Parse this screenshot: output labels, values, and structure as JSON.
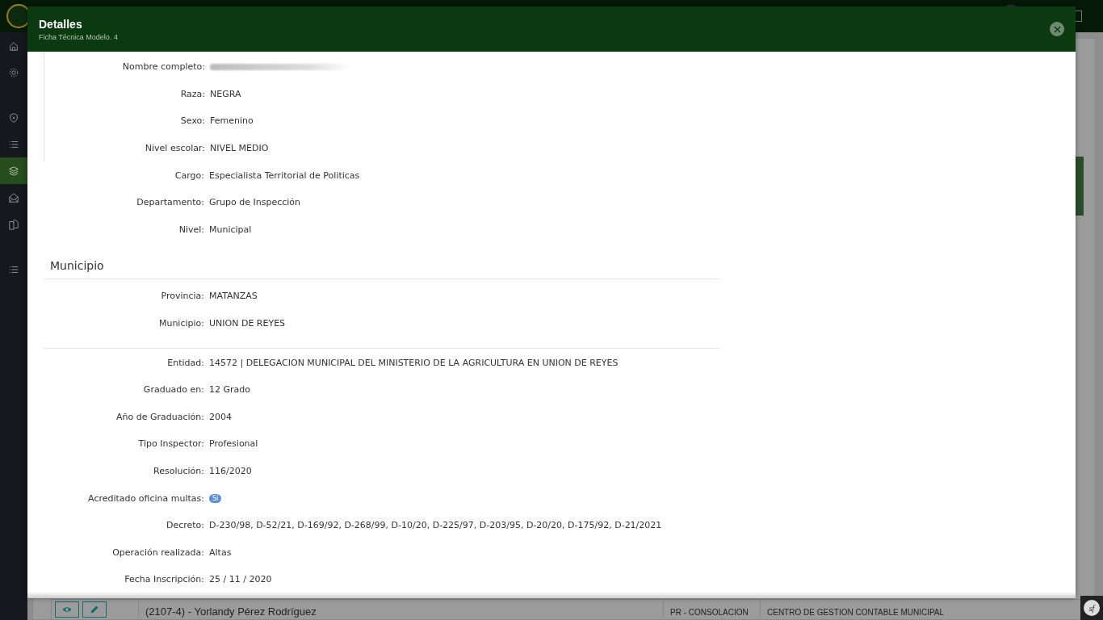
{
  "sidebar": {
    "items": [
      {
        "kind": "home",
        "selected": false
      },
      {
        "kind": "gear",
        "selected": false
      },
      {
        "kind": "shield",
        "selected": false
      },
      {
        "kind": "list",
        "selected": false
      },
      {
        "kind": "layers",
        "selected": true
      },
      {
        "kind": "envelope",
        "selected": false
      },
      {
        "kind": "copy",
        "selected": false
      },
      {
        "kind": "list",
        "selected": false
      }
    ]
  },
  "background_table": {
    "rows": [
      {
        "name": "(2107-4) - Yorlandy Pérez Rodríguez",
        "column_3": "PR - CONSOLACION",
        "column_4": "CENTRO DE GESTION CONTABLE MUNICIPAL"
      }
    ]
  },
  "debug_badge": {
    "text": "sf"
  },
  "modal": {
    "title": "Detalles",
    "subtitle": "Ficha Técnica Modelo. 4",
    "groups": [
      {
        "kind": "bordered",
        "fields": [
          {
            "label": "Nombre completo:",
            "kind": "redacted"
          },
          {
            "label": "Raza:",
            "value": "NEGRA",
            "kind": "text"
          },
          {
            "label": "Sexo:",
            "value": "Femenino",
            "kind": "text"
          },
          {
            "label": "Nivel escolar:",
            "value": "NIVEL MEDIO",
            "kind": "text"
          }
        ]
      },
      {
        "kind": "plain",
        "fields": [
          {
            "label": "Cargo:",
            "value": "Especialista Territorial de Politicas",
            "kind": "text"
          },
          {
            "label": "Departamento:",
            "value": "Grupo de Inspección",
            "kind": "text"
          },
          {
            "label": "Nivel:",
            "value": "Municipal",
            "kind": "text"
          }
        ]
      },
      {
        "kind": "section",
        "heading": "Municipio",
        "fields": [
          {
            "label": "Provincia:",
            "value": "MATANZAS",
            "kind": "text"
          },
          {
            "label": "Municipio:",
            "value": "UNION DE REYES",
            "kind": "text"
          }
        ]
      },
      {
        "kind": "plain",
        "fields": [
          {
            "label": "Entidad:",
            "value": "14572 | DELEGACION MUNICIPAL DEL MINISTERIO DE LA AGRICULTURA EN UNION DE REYES",
            "kind": "text"
          },
          {
            "label": "Graduado en:",
            "value": "12 Grado",
            "kind": "text"
          },
          {
            "label": "Año de Graduación:",
            "value": "2004",
            "kind": "text"
          },
          {
            "label": "Tipo Inspector:",
            "value": "Profesional",
            "kind": "text"
          },
          {
            "label": "Resolución:",
            "value": "116/2020",
            "kind": "text"
          },
          {
            "label": "Acreditado oficina multas:",
            "value": "Sí",
            "kind": "badge"
          },
          {
            "label": "Decreto:",
            "value": "D-230/98, D-52/21, D-169/92, D-268/99, D-10/20, D-225/97, D-203/95, D-20/20, D-175/92, D-21/2021",
            "kind": "text"
          },
          {
            "label": "Operación realizada:",
            "value": "Altas",
            "kind": "text"
          },
          {
            "label": "Fecha Inscripción:",
            "value": "25 / 11 / 2020",
            "kind": "text"
          }
        ]
      }
    ]
  }
}
